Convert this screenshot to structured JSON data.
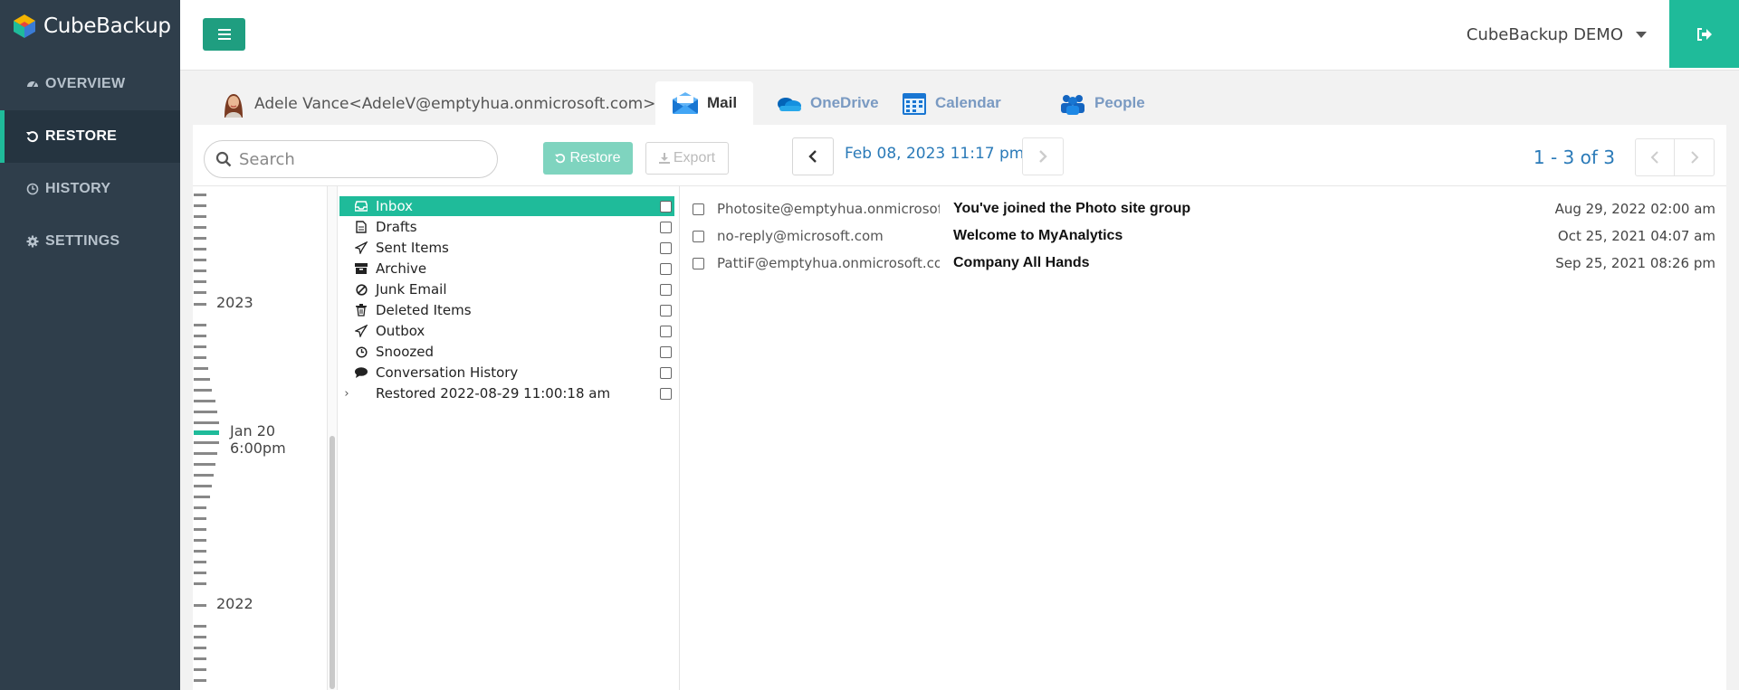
{
  "app": {
    "name": "CubeBackup"
  },
  "sidebar": {
    "items": [
      {
        "label": "OVERVIEW",
        "icon": "dashboard-icon",
        "active": false
      },
      {
        "label": "RESTORE",
        "icon": "undo-icon",
        "active": true
      },
      {
        "label": "HISTORY",
        "icon": "clock-icon",
        "active": false
      },
      {
        "label": "SETTINGS",
        "icon": "gear-icon",
        "active": false
      }
    ]
  },
  "header": {
    "user_menu_label": "CubeBackup DEMO"
  },
  "account": {
    "label": "Adele Vance<AdeleV@emptyhua.onmicrosoft.com>"
  },
  "tabs": [
    {
      "label": "Mail",
      "icon": "mail-icon",
      "active": true
    },
    {
      "label": "OneDrive",
      "icon": "cloud-icon",
      "active": false
    },
    {
      "label": "Calendar",
      "icon": "calendar-icon",
      "active": false
    },
    {
      "label": "People",
      "icon": "people-icon",
      "active": false
    }
  ],
  "toolbar": {
    "search_placeholder": "Search",
    "restore_label": "Restore",
    "export_label": "Export",
    "snapshot_date": "Feb 08, 2023 11:17 pm",
    "pager_text": "1 - 3 of 3"
  },
  "timeline": {
    "labels": [
      "2023",
      "Jan 20 6:00pm",
      "2022"
    ],
    "selected": "Jan 20 6:00pm",
    "accent_color": "#1fbb9a"
  },
  "folders": [
    {
      "label": "Inbox",
      "icon": "inbox-icon",
      "active": true
    },
    {
      "label": "Drafts",
      "icon": "document-icon",
      "active": false
    },
    {
      "label": "Sent Items",
      "icon": "send-icon",
      "active": false
    },
    {
      "label": "Archive",
      "icon": "archive-icon",
      "active": false
    },
    {
      "label": "Junk Email",
      "icon": "ban-icon",
      "active": false
    },
    {
      "label": "Deleted Items",
      "icon": "trash-icon",
      "active": false
    },
    {
      "label": "Outbox",
      "icon": "send-icon",
      "active": false
    },
    {
      "label": "Snoozed",
      "icon": "clock-icon",
      "active": false
    },
    {
      "label": "Conversation History",
      "icon": "chat-icon",
      "active": false
    },
    {
      "label": "Restored 2022-08-29 11:00:18 am",
      "icon": "",
      "active": false,
      "expandable": true
    }
  ],
  "messages": [
    {
      "from": "Photosite@emptyhua.onmicrosoft.com",
      "subject": "You've joined the Photo site group",
      "date": "Aug 29, 2022 02:00 am"
    },
    {
      "from": "no-reply@microsoft.com",
      "subject": "Welcome to MyAnalytics",
      "date": "Oct 25, 2021 04:07 am"
    },
    {
      "from": "PattiF@emptyhua.onmicrosoft.com",
      "subject": "Company All Hands",
      "date": "Sep 25, 2021 08:26 pm"
    }
  ],
  "colors": {
    "sidebar_bg": "#2f3e4b",
    "accent": "#1fbb9a",
    "link": "#2a7ab8"
  }
}
